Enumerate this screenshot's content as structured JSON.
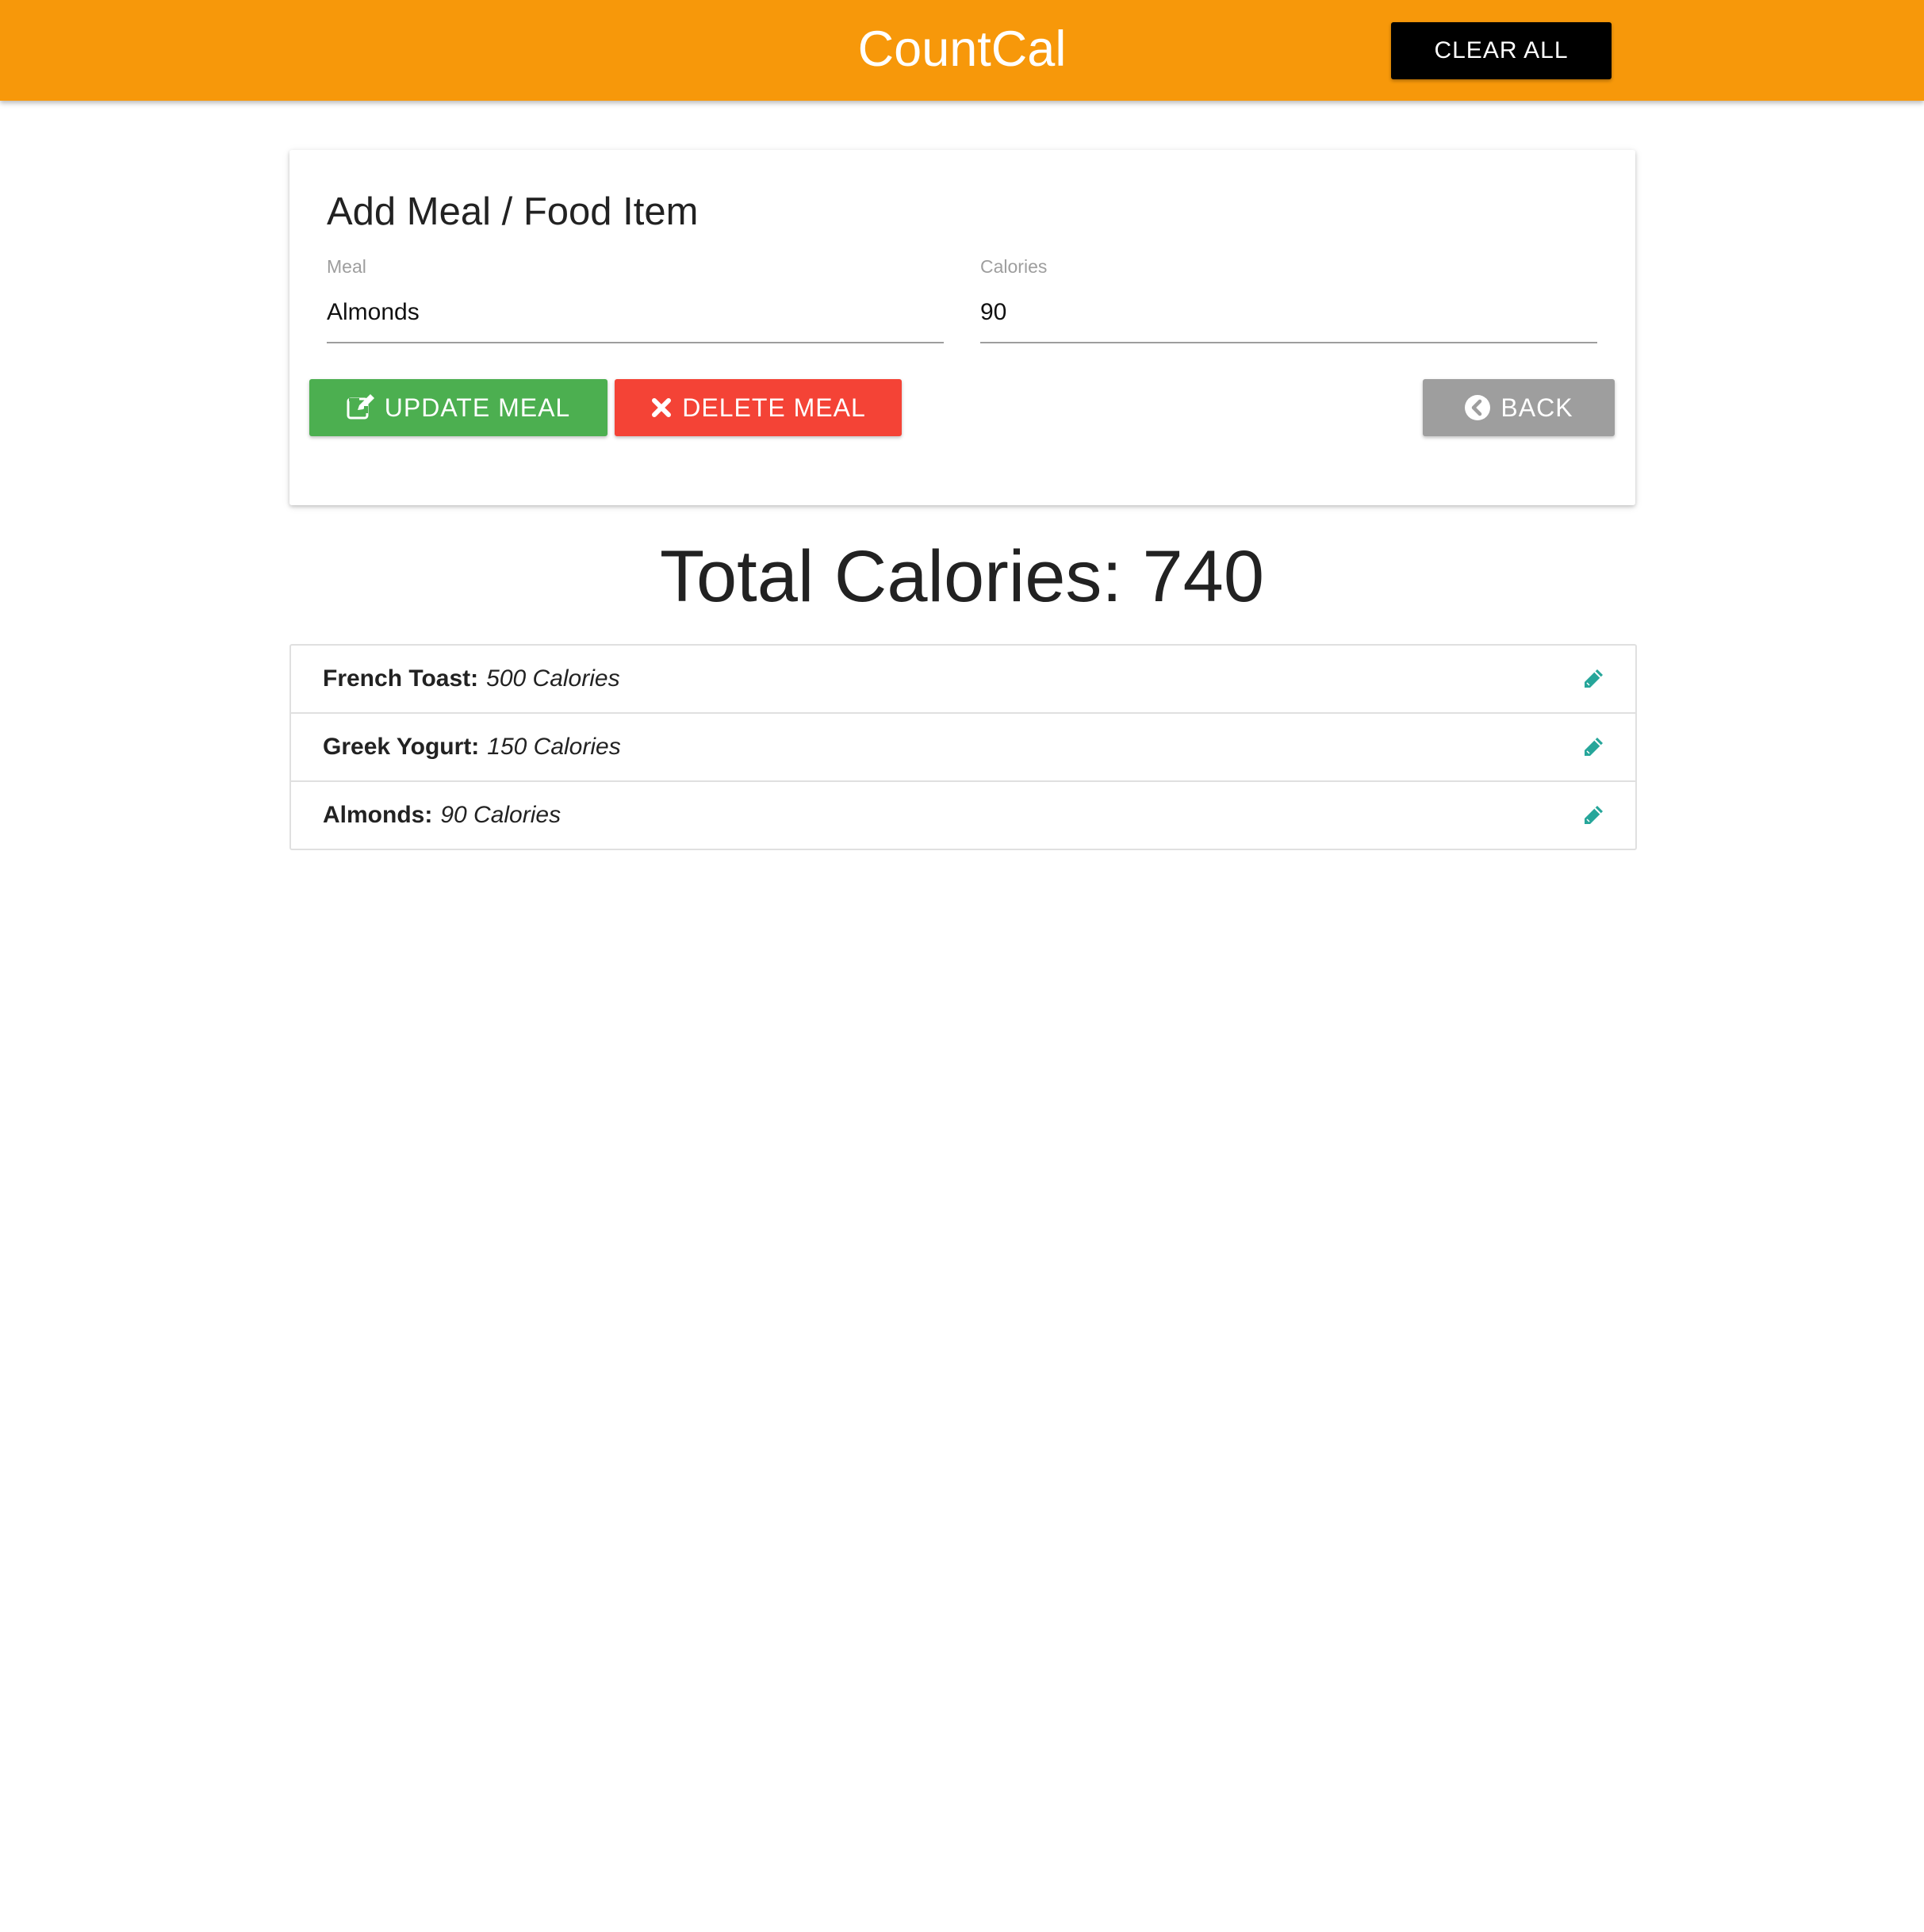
{
  "navbar": {
    "brand": "CountCal",
    "clear_all_label": "CLEAR ALL",
    "color": "#f7980a"
  },
  "form": {
    "title": "Add Meal / Food Item",
    "meal": {
      "label": "Meal",
      "value": "Almonds"
    },
    "calories": {
      "label": "Calories",
      "value": "90"
    },
    "update_label": "UPDATE MEAL",
    "delete_label": "DELETE MEAL",
    "back_label": "BACK",
    "update_icon": "edit-icon",
    "delete_icon": "close-icon",
    "back_icon": "chevron-circle-left-icon",
    "update_color": "#4caf50",
    "delete_color": "#f44336",
    "back_color": "#9e9e9e"
  },
  "total": {
    "text": "Total Calories: 740"
  },
  "items": [
    {
      "name": "French Toast:",
      "calories": "500 Calories",
      "icon": "pencil-icon"
    },
    {
      "name": "Greek Yogurt:",
      "calories": "150 Calories",
      "icon": "pencil-icon"
    },
    {
      "name": "Almonds:",
      "calories": "90 Calories",
      "icon": "pencil-icon"
    }
  ],
  "accent": {
    "edit_icon_color": "#26a69a"
  }
}
